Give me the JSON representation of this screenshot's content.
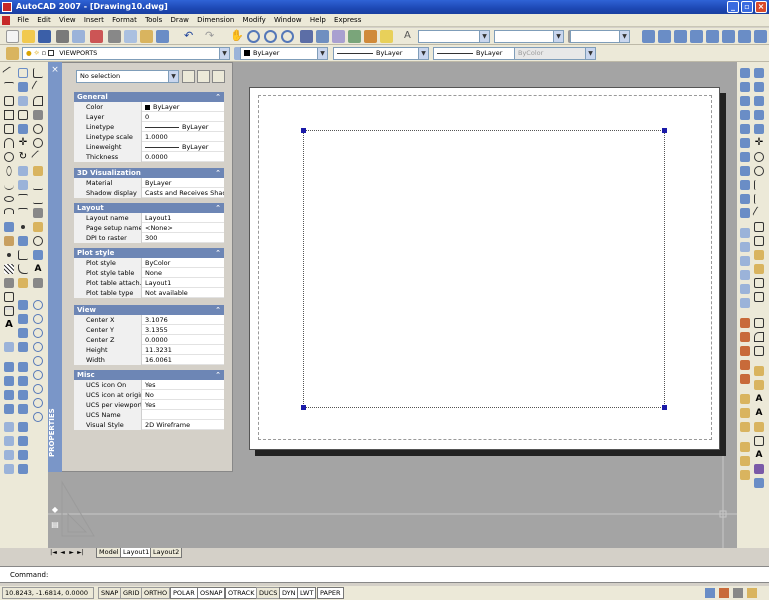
{
  "window": {
    "title": "AutoCAD 2007 - [Drawing10.dwg]",
    "minimize": "_",
    "restore": "▫",
    "close": "×"
  },
  "menu": [
    "File",
    "Edit",
    "View",
    "Insert",
    "Format",
    "Tools",
    "Draw",
    "Dimension",
    "Modify",
    "Window",
    "Help",
    "Express"
  ],
  "layer_toolbar": {
    "layer_name": "VIEWPORTS",
    "color": "ByLayer",
    "linetype": "ByLayer",
    "lineweight": "ByLayer",
    "plotstyle": "ByColor"
  },
  "properties": {
    "palette_title": "PROPERTIES",
    "close_glyph": "×",
    "selection": "No selection",
    "sections": [
      {
        "title": "General",
        "rows": [
          {
            "name": "Color",
            "value": "ByLayer",
            "swatch": true
          },
          {
            "name": "Layer",
            "value": "0"
          },
          {
            "name": "Linetype",
            "value": "ByLayer",
            "line": true
          },
          {
            "name": "Linetype scale",
            "value": "1.0000"
          },
          {
            "name": "Lineweight",
            "value": "ByLayer",
            "line": true
          },
          {
            "name": "Thickness",
            "value": "0.0000"
          }
        ]
      },
      {
        "title": "3D Visualization",
        "rows": [
          {
            "name": "Material",
            "value": "ByLayer"
          },
          {
            "name": "Shadow display",
            "value": "Casts and Receives Shad..."
          }
        ]
      },
      {
        "title": "Layout",
        "rows": [
          {
            "name": "Layout name",
            "value": "Layout1"
          },
          {
            "name": "Page setup name",
            "value": "<None>"
          },
          {
            "name": "DPI to raster",
            "value": "300"
          }
        ]
      },
      {
        "title": "Plot style",
        "rows": [
          {
            "name": "Plot style",
            "value": "ByColor"
          },
          {
            "name": "Plot style table",
            "value": "None"
          },
          {
            "name": "Plot table attach...",
            "value": "Layout1"
          },
          {
            "name": "Plot table type",
            "value": "Not available"
          }
        ]
      },
      {
        "title": "View",
        "rows": [
          {
            "name": "Center X",
            "value": "3.1076"
          },
          {
            "name": "Center Y",
            "value": "3.1355"
          },
          {
            "name": "Center Z",
            "value": "0.0000"
          },
          {
            "name": "Height",
            "value": "11.3231"
          },
          {
            "name": "Width",
            "value": "16.0061"
          }
        ]
      },
      {
        "title": "Misc",
        "rows": [
          {
            "name": "UCS icon On",
            "value": "Yes"
          },
          {
            "name": "UCS icon at origin",
            "value": "No"
          },
          {
            "name": "UCS per viewport",
            "value": "Yes"
          },
          {
            "name": "UCS Name",
            "value": ""
          },
          {
            "name": "Visual Style",
            "value": "2D Wireframe"
          }
        ]
      }
    ]
  },
  "tabs": [
    "Model",
    "Layout1",
    "Layout2"
  ],
  "active_tab": "Layout1",
  "command": "Command:",
  "status": {
    "coords": "10.8243, -1.6814, 0.0000",
    "toggles": [
      "SNAP",
      "GRID",
      "ORTHO",
      "POLAR",
      "OSNAP",
      "OTRACK",
      "DUCS",
      "DYN",
      "LWT",
      "PAPER"
    ],
    "active": [
      "POLAR",
      "OSNAP",
      "OTRACK",
      "DYN",
      "LWT",
      "PAPER"
    ]
  },
  "colors": {
    "title_blue": "#1d48b4",
    "palette_header": "#6d86b5",
    "drawing_bg": "#a4a4a4",
    "grip": "#1a1aa8"
  },
  "icons": [
    "open-icon",
    "save-icon",
    "print-icon",
    "undo-icon",
    "redo-icon",
    "pan-icon",
    "zoom-icon",
    "line-icon",
    "circle-icon",
    "arc-icon",
    "text-icon",
    "move-icon",
    "copy-icon",
    "rotate-icon",
    "erase-icon"
  ]
}
